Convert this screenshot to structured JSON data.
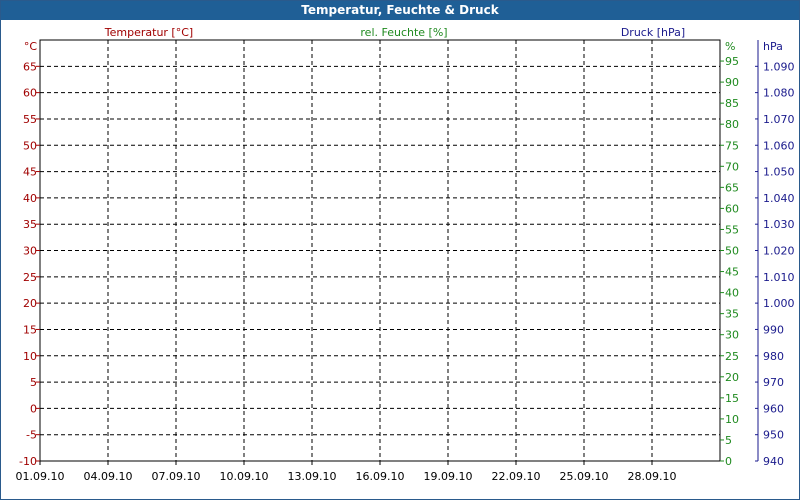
{
  "window": {
    "title": "Temperatur, Feuchte & Druck"
  },
  "colors": {
    "temperature": "#a00000",
    "humidity": "#1f8a1f",
    "pressure": "#1a1a8c",
    "grid": "#000000",
    "titlebar": "#1f5f96"
  },
  "chart_data": {
    "type": "line",
    "title": "Temperatur, Feuchte & Druck",
    "series": [],
    "x_axis": {
      "type": "date",
      "range": [
        "01.09.10",
        "01.10.10"
      ],
      "ticks": [
        "01.09.10",
        "04.09.10",
        "07.09.10",
        "10.09.10",
        "13.09.10",
        "16.09.10",
        "19.09.10",
        "22.09.10",
        "25.09.10",
        "28.09.10"
      ]
    },
    "y_axes": [
      {
        "id": "temperature",
        "label": "Temperatur [°C]",
        "unit": "°C",
        "range": [
          -10,
          70
        ],
        "ticks": [
          -10,
          -5,
          0,
          5,
          10,
          15,
          20,
          25,
          30,
          35,
          40,
          45,
          50,
          55,
          60,
          65
        ]
      },
      {
        "id": "humidity",
        "label": "rel. Feuchte [%]",
        "unit": "%",
        "range": [
          0,
          100
        ],
        "ticks": [
          0,
          5,
          10,
          15,
          20,
          25,
          30,
          35,
          40,
          45,
          50,
          55,
          60,
          65,
          70,
          75,
          80,
          85,
          90,
          95
        ]
      },
      {
        "id": "pressure",
        "label": "Druck [hPa]",
        "unit": "hPa",
        "range": [
          940,
          1100
        ],
        "ticks": [
          "940",
          "950",
          "960",
          "970",
          "980",
          "990",
          "1.000",
          "1.010",
          "1.020",
          "1.030",
          "1.040",
          "1.050",
          "1.060",
          "1.070",
          "1.080",
          "1.090"
        ]
      }
    ],
    "grid": true,
    "grid_style": "dashed"
  }
}
